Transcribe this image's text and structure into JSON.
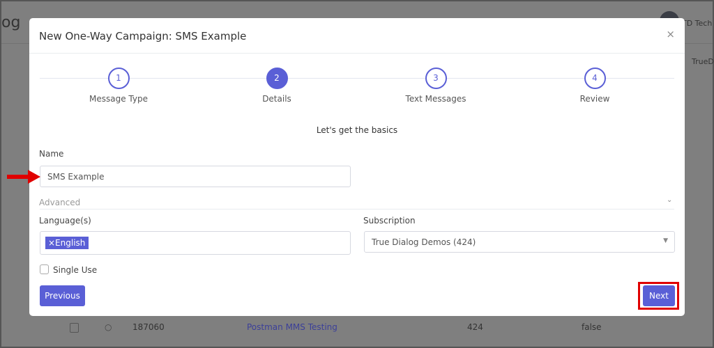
{
  "background": {
    "title_fragment": "og",
    "user_label": "TD Tech",
    "column_fragment": "TrueD",
    "row": {
      "id": "187060",
      "name": "Postman MMS Testing",
      "account": "424",
      "flag": "false"
    }
  },
  "modal": {
    "title": "New One-Way Campaign: SMS Example",
    "close_icon": "×",
    "steps": [
      {
        "num": "1",
        "label": "Message Type"
      },
      {
        "num": "2",
        "label": "Details",
        "active": true
      },
      {
        "num": "3",
        "label": "Text Messages"
      },
      {
        "num": "4",
        "label": "Review"
      }
    ],
    "subtitle": "Let's get the basics",
    "name_label": "Name",
    "name_value": "SMS Example",
    "advanced_label": "Advanced",
    "languages_label": "Language(s)",
    "language_tag": "×English",
    "subscription_label": "Subscription",
    "subscription_value": "True Dialog Demos (424)",
    "single_use_label": "Single Use",
    "single_use_checked": false,
    "previous_label": "Previous",
    "next_label": "Next"
  },
  "colors": {
    "accent": "#5a5fd6",
    "highlight": "#e00000"
  }
}
